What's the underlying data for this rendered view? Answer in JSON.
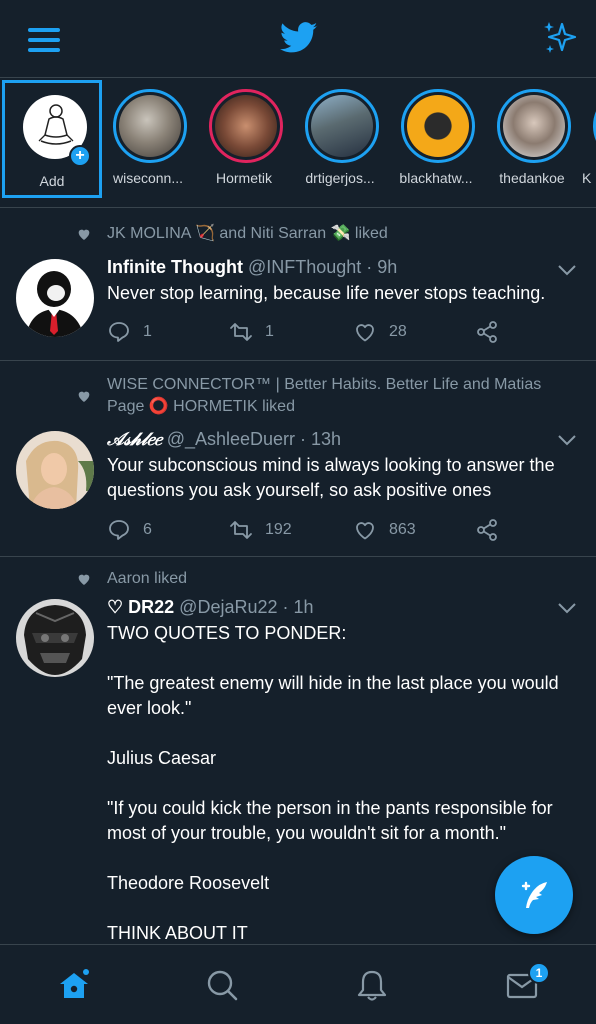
{
  "colors": {
    "background": "#15202b",
    "accent": "#1da1f2",
    "muted": "#8899a6",
    "divider": "#38444d"
  },
  "fleets": [
    {
      "name": "Add"
    },
    {
      "name": "wiseconn..."
    },
    {
      "name": "Hormetik"
    },
    {
      "name": "drtigerjos..."
    },
    {
      "name": "blackhatw..."
    },
    {
      "name": "thedankoe"
    },
    {
      "name": "K"
    }
  ],
  "tweets": [
    {
      "social": "JK MOLINA 🏹 and Niti Sarran 💸 liked",
      "display_name": "Infinite Thought",
      "meta": " @INFThought · 9h",
      "text": "Never stop learning, because life never stops teaching.",
      "replies": "1",
      "retweets": "1",
      "likes": "28"
    },
    {
      "social": "WISE CONNECTOR™ | Better Habits. Better Life and Matias Page ⭕ HORMETIK liked",
      "display_name": "𝒜𝓈𝒽𝓁𝑒𝑒",
      "meta": " @_AshleeDuerr · 13h",
      "text": "Your subconscious mind is always looking to answer the questions you ask yourself, so ask positive ones",
      "replies": "6",
      "retweets": "192",
      "likes": "863"
    },
    {
      "social": "Aaron liked",
      "display_name": "♡ DR22",
      "meta": " @DejaRu22 · 1h",
      "text": "TWO QUOTES TO PONDER:\n\n\"The greatest enemy will hide in the last place you would ever look.\"\n\nJulius Caesar\n\n\"If you could kick the person in the pants responsible for most of your trouble, you wouldn't sit for a month.\"\n\nTheodore Roosevelt\n\nTHINK ABOUT IT"
    }
  ],
  "bottom_nav": {
    "messages_badge": "1"
  },
  "icons": [
    "menu-icon",
    "twitter-bird-icon",
    "sparkle-icon",
    "reply-icon",
    "retweet-icon",
    "like-icon",
    "share-icon",
    "chevron-down-icon",
    "compose-icon",
    "home-icon",
    "search-icon",
    "bell-icon",
    "mail-icon"
  ]
}
